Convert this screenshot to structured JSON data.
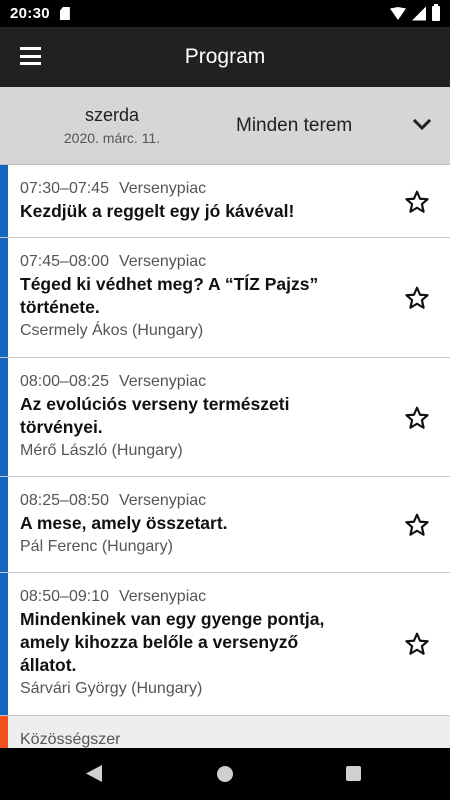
{
  "status_bar": {
    "time": "20:30"
  },
  "app_bar": {
    "title": "Program",
    "menu_icon": "menu-icon"
  },
  "filter": {
    "day_name": "szerda",
    "day_date": "2020. márc. 11.",
    "room": "Minden terem",
    "dropdown_icon": "chevron-down-icon"
  },
  "colors": {
    "versenypiac": "#1565c0",
    "kozossegszer": "#f4511e",
    "app_bar": "#212121",
    "filter_bar": "#d6d6d6"
  },
  "sessions": [
    {
      "time": "07:30–07:45",
      "track": "Versenypiac",
      "title": "Kezdjük a reggelt egy jó kávéval!",
      "speaker": ""
    },
    {
      "time": "07:45–08:00",
      "track": "Versenypiac",
      "title_lines": [
        "Téged ki védhet meg? A “TÍZ Pajzs”",
        "története."
      ],
      "speaker": "Csermely Ákos (Hungary)"
    },
    {
      "time": "08:00–08:25",
      "track": "Versenypiac",
      "title_lines": [
        "Az evolúciós verseny természeti",
        "törvényei."
      ],
      "speaker": "Mérő László (Hungary)"
    },
    {
      "time": "08:25–08:50",
      "track": "Versenypiac",
      "title": "A mese, amely összetart.",
      "speaker": "Pál Ferenc (Hungary)"
    },
    {
      "time": "08:50–09:10",
      "track": "Versenypiac",
      "title_lines": [
        "Mindenkinek van egy gyenge pontja,",
        "amely kihozza belőle a versenyző",
        "állatot."
      ],
      "speaker": "Sárvári György (Hungary)"
    },
    {
      "track": "Közösségszer"
    }
  ]
}
